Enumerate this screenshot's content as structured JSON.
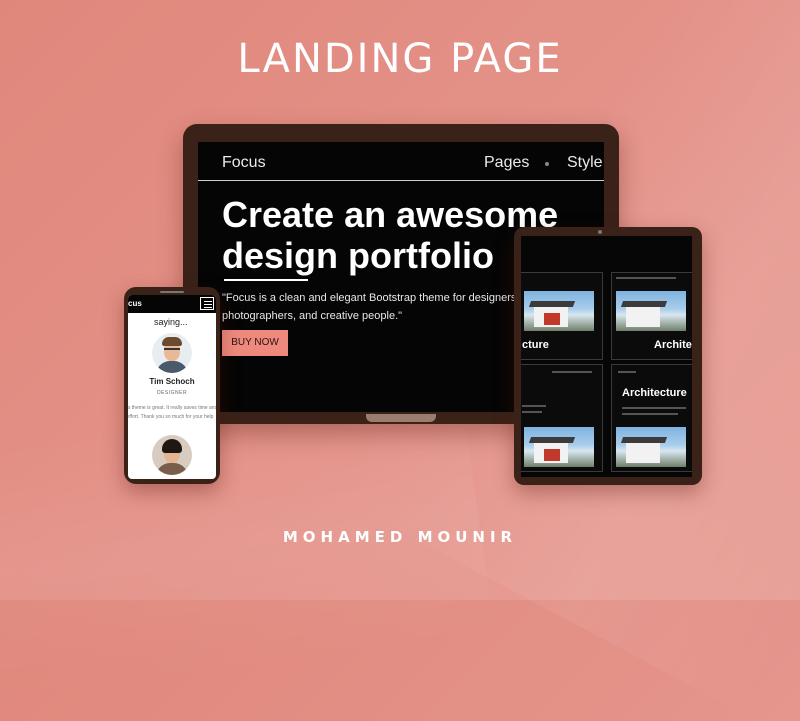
{
  "page": {
    "title": "LANDING PAGE",
    "author": "MOHAMED MOUNIR",
    "colors": {
      "background": "#e4938a",
      "device_frame": "#3a2218",
      "accent": "#ee8a7d"
    }
  },
  "laptop": {
    "nav": {
      "brand": "Focus",
      "pages": "Pages",
      "style": "Style"
    },
    "hero": {
      "title": "Create an awesome design portfolio",
      "quote": "\"Focus is a clean and elegant Bootstrap theme for designers, architects, photographers, and creative people.\"",
      "button": "BUY NOW"
    }
  },
  "tablet": {
    "labels": [
      "cture",
      "Archite",
      "Architecture"
    ]
  },
  "phone": {
    "brand": "cus",
    "heading": "saying...",
    "person1": {
      "name": "Tim Schoch",
      "role": "DESIGNER",
      "quote": "cus theme is great. It really saves time and effort. Thank you so much for your help"
    },
    "icons": {
      "menu": "hamburger-icon"
    }
  }
}
